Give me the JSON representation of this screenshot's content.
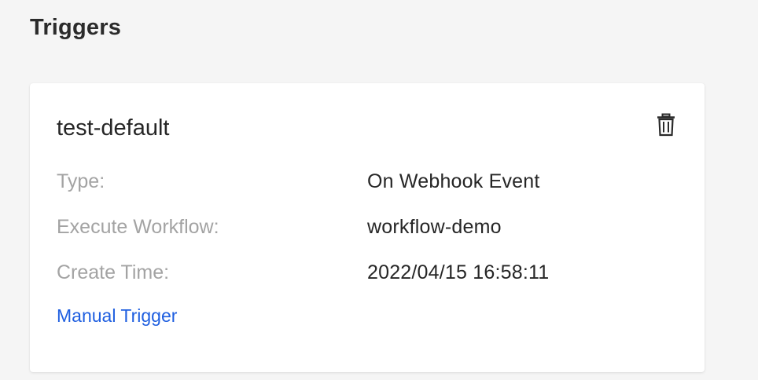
{
  "page": {
    "title": "Triggers"
  },
  "trigger": {
    "name": "test-default",
    "delete_icon": "trash-icon",
    "fields": {
      "type": {
        "label": "Type:",
        "value": "On Webhook Event"
      },
      "workflow": {
        "label": "Execute Workflow:",
        "value": "workflow-demo"
      },
      "create_time": {
        "label": "Create Time:",
        "value": "2022/04/15 16:58:11"
      }
    },
    "manual_trigger_label": "Manual Trigger"
  },
  "colors": {
    "background": "#f5f5f5",
    "card": "#ffffff",
    "label": "#a3a3a3",
    "value": "#262626",
    "link": "#1f5fe0"
  }
}
